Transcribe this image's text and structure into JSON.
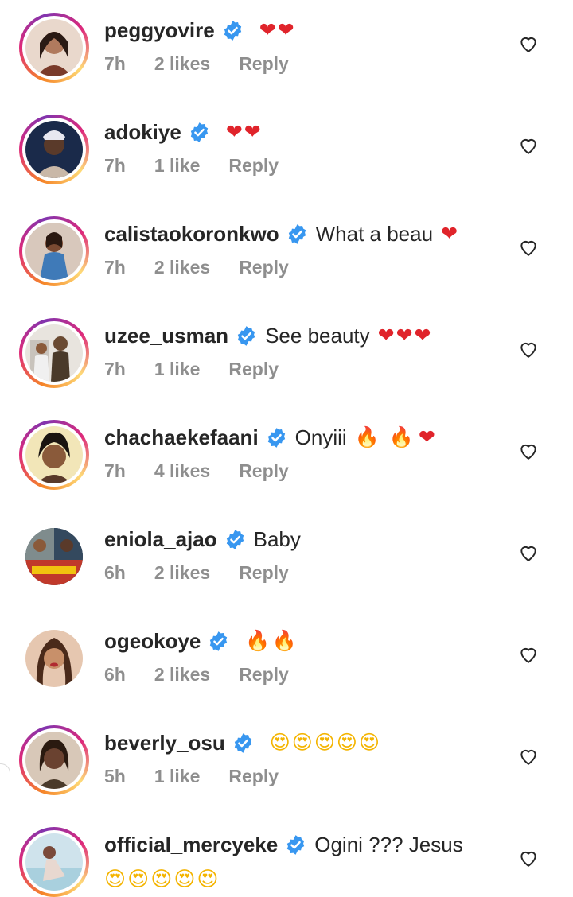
{
  "comments": [
    {
      "username": "peggyovire",
      "text": "",
      "emoji": "❤❤",
      "emoji_kind": "heart",
      "time": "7h",
      "likes": "2 likes",
      "reply": "Reply",
      "avatar_colors": [
        "#7a3b2a",
        "#d9a38a"
      ]
    },
    {
      "username": "adokiye",
      "text": "",
      "emoji": "❤❤",
      "emoji_kind": "heart",
      "time": "7h",
      "likes": "1 like",
      "reply": "Reply",
      "avatar_colors": [
        "#1a2a4a",
        "#c9b8a8"
      ]
    },
    {
      "username": "calistaokoronkwo",
      "text": "What a beau",
      "emoji": "❤",
      "emoji_kind": "heart",
      "time": "7h",
      "likes": "2 likes",
      "reply": "Reply",
      "avatar_colors": [
        "#6b3f2a",
        "#3f7ab8"
      ]
    },
    {
      "username": "uzee_usman",
      "text": "See beauty",
      "emoji": "❤❤❤",
      "emoji_kind": "heart",
      "time": "7h",
      "likes": "1 like",
      "reply": "Reply",
      "avatar_colors": [
        "#c8c3bc",
        "#6a5a4a"
      ]
    },
    {
      "username": "chachaekefaani",
      "text": "Onyiii",
      "emoji": "🔥 🔥",
      "emoji2": "❤",
      "emoji_kind": "fire",
      "time": "7h",
      "likes": "4 likes",
      "reply": "Reply",
      "avatar_colors": [
        "#f2e6b8",
        "#5a3a2a"
      ]
    },
    {
      "username": "eniola_ajao",
      "text": "Baby",
      "emoji": "",
      "emoji_kind": "",
      "time": "6h",
      "likes": "2 likes",
      "reply": "Reply",
      "avatar_colors": [
        "#c0392b",
        "#2c3e50"
      ]
    },
    {
      "username": "ogeokoye",
      "text": "",
      "emoji": "🔥🔥",
      "emoji_kind": "fire",
      "time": "6h",
      "likes": "2 likes",
      "reply": "Reply",
      "avatar_colors": [
        "#8a5a3a",
        "#e6c7b0"
      ]
    },
    {
      "username": "beverly_osu",
      "text": "",
      "emoji": "😍😍😍😍😍",
      "emoji_kind": "smile",
      "time": "5h",
      "likes": "1 like",
      "reply": "Reply",
      "avatar_colors": [
        "#d8c8b8",
        "#4a3a2a"
      ]
    },
    {
      "username": "official_mercyeke",
      "text": "Ogini ??? Jesus",
      "emoji": "",
      "emoji_line2": "😍😍😍😍😍",
      "emoji_kind": "smile",
      "time": "",
      "likes": "",
      "reply": "",
      "avatar_colors": [
        "#cfe3ec",
        "#7a4a3a"
      ]
    }
  ],
  "icons": {
    "verified": "verified-badge-icon",
    "like": "heart-outline-icon"
  },
  "colors": {
    "verified": "#3897f0",
    "meta": "#8e8e8e",
    "heart": "#e0242b"
  }
}
